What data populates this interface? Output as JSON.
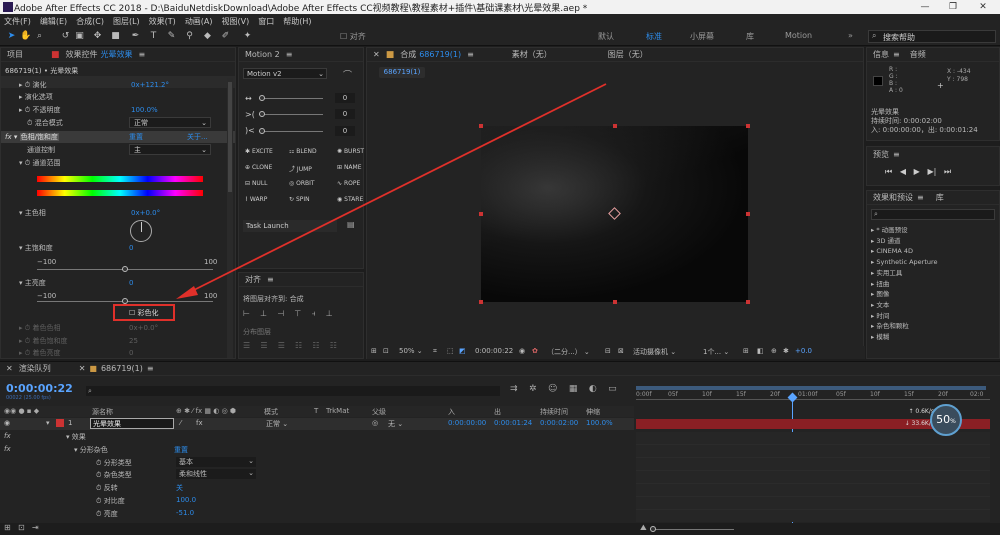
{
  "title": "Adobe After Effects CC 2018 - D:\\BaiduNetdiskDownload\\Adobe After Effects CC视频教程\\教程素材+插件\\基础课素材\\光晕效果.aep *",
  "window_controls": [
    "—",
    "❐",
    "✕"
  ],
  "menu": [
    "文件(F)",
    "编辑(E)",
    "合成(C)",
    "图层(L)",
    "效果(T)",
    "动画(A)",
    "视图(V)",
    "窗口",
    "帮助(H)"
  ],
  "toolbar": {
    "align_label": "对齐",
    "workspaces": [
      "默认",
      "标准",
      "小屏幕",
      "库",
      "Motion"
    ],
    "more": "»",
    "search_placeholder": "搜索帮助"
  },
  "effects_panel": {
    "tab_project": "项目",
    "tab_effects": "效果控件",
    "tab_effects_layer": "光晕效果",
    "breadcrumb": "686719(1) • 光晕效果",
    "rows": [
      {
        "label": "演化",
        "value": "0x+121.2°"
      },
      {
        "label": "演化选项",
        "value": ""
      },
      {
        "label": "不透明度",
        "value": "100.0%"
      },
      {
        "label": "混合模式",
        "value": "正常"
      },
      {
        "label": "色相/饱和度",
        "value": "重置",
        "extra": "关于..."
      },
      {
        "label": "通道控制",
        "value": "主"
      },
      {
        "label": "通道范围",
        "value": ""
      },
      {
        "label": "主色相",
        "value": "0x+0.0°"
      },
      {
        "label": "主饱和度",
        "value": "0"
      },
      {
        "label": "主亮度",
        "value": "0"
      },
      {
        "label": "着色色相",
        "value": "0x+0.0°"
      },
      {
        "label": "着色饱和度",
        "value": "25"
      },
      {
        "label": "着色亮度",
        "value": "0"
      }
    ],
    "range_min": "−100",
    "range_max": "100",
    "colorize_label": "彩色化"
  },
  "motion_panel": {
    "tab": "Motion 2",
    "dropdown": "Motion v2",
    "inputs": [
      "0",
      "0",
      "0"
    ],
    "buttons": [
      "EXCITE",
      "BLEND",
      "BURST",
      "CLONE",
      "JUMP",
      "NAME",
      "NULL",
      "ORBIT",
      "ROPE",
      "WARP",
      "SPIN",
      "STARE"
    ],
    "task": "Task Launch"
  },
  "align_panel": {
    "tab": "对齐",
    "align_to_label": "将图层对齐到:",
    "align_to_value": "合成",
    "distribute_label": "分布图层"
  },
  "composition_panel": {
    "tab_comp": "合成",
    "tab_comp_name": "686719(1)",
    "tab_footage": "素材（无）",
    "tab_layer": "图层（无）",
    "comp_tab_chip": "686719(1)",
    "footer": {
      "zoom": "50%",
      "timecode": "0:00:00:22",
      "resolution": "（二分...）",
      "camera": "活动摄像机",
      "views": "1个...",
      "exposure": "+0.0"
    }
  },
  "info_panel": {
    "tab_info": "信息",
    "tab_audio": "音频",
    "rgba": [
      "R :",
      "G :",
      "B :",
      "A : 0"
    ],
    "xy": [
      "X : -434",
      "Y : 798"
    ],
    "layer_name": "光晕效果",
    "duration": "持续时间: 0:00:02:00",
    "in_out": "入: 0:00:00:00，出: 0:00:01:24"
  },
  "preview_panel": {
    "tab": "预览"
  },
  "effects_presets": {
    "tab": "效果和预设",
    "tab_lib": "库",
    "items": [
      "* 动画预设",
      "3D 通道",
      "CINEMA 4D",
      "Synthetic Aperture",
      "实用工具",
      "扭曲",
      "图像",
      "文本",
      "时间",
      "杂色和颗粒",
      "模糊"
    ]
  },
  "timeline": {
    "tab_render": "渲染队列",
    "tab_comp": "686719(1)",
    "timecode": "0:00:00:22",
    "frames": "00022 (25.00 fps)",
    "columns": {
      "name": "源名称",
      "mode": "模式",
      "t": "T",
      "trkmat": "TrkMat",
      "parent": "父级",
      "in": "入",
      "out": "出",
      "duration": "持续时间",
      "stretch": "伸缩"
    },
    "layer": {
      "index": "1",
      "name": "光晕效果",
      "mode": "正常",
      "parent": "无",
      "in": "0:00:00:00",
      "out": "0:00:01:24",
      "duration": "0:00:02:00",
      "stretch": "100.0%"
    },
    "sub_rows": [
      {
        "label": "效果",
        "value": ""
      },
      {
        "label": "分形杂色",
        "value": "重置"
      },
      {
        "label": "分形类型",
        "value": "基本"
      },
      {
        "label": "杂色类型",
        "value": "柔和线性"
      },
      {
        "label": "反转",
        "value": "关"
      },
      {
        "label": "对比度",
        "value": "100.0"
      },
      {
        "label": "亮度",
        "value": "-51.0"
      }
    ],
    "ruler": [
      "0:00f",
      "05f",
      "10f",
      "15f",
      "20f",
      "01:00f",
      "05f",
      "10f",
      "15f",
      "20f",
      "02:0"
    ],
    "net_up": "0.6K/s",
    "net_down": "33.6K/s",
    "cpu_percent": "50",
    "cpu_unit": "%"
  }
}
